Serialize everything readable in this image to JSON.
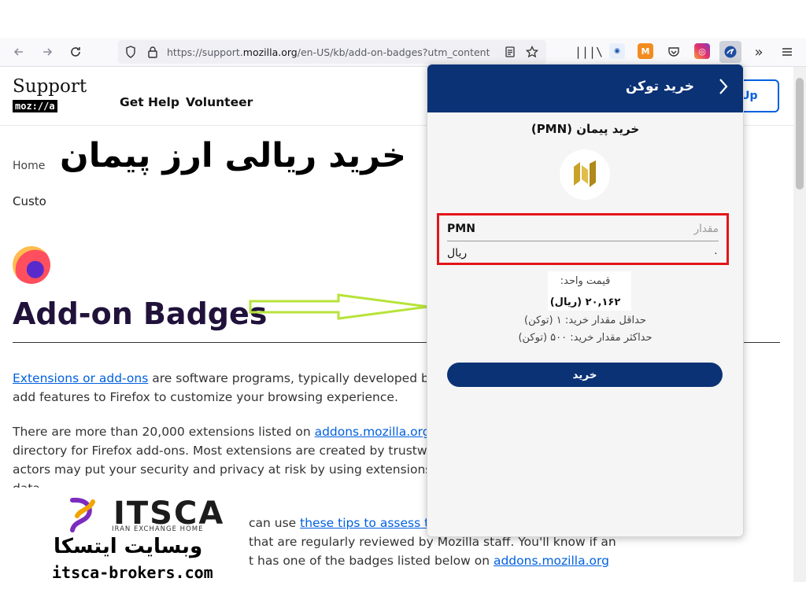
{
  "browser": {
    "url_prefix": "https://support.",
    "url_domain": "mozilla.org",
    "url_rest": "/en-US/kb/add-on-badges?utm_content="
  },
  "site": {
    "logo_text": "Support",
    "logo_moz": "moz://a",
    "nav": [
      "Get Help",
      "Volunteer"
    ],
    "signup_label": "/Up",
    "breadcrumb_home": "Home",
    "breadcrumb_custom": "Custo",
    "page_title": "Add-on Badges",
    "para1": {
      "link": "Extensions or add-ons",
      "line1_rest": " are software programs, typically developed by",
      "line2": "add features to Firefox to customize your browsing experience."
    },
    "para2": {
      "line1_text": "There are more than 20,000 extensions listed on ",
      "line1_link": "addons.mozilla.org (",
      "line2": "directory for Firefox add-ons. Most extensions are created by trustwo",
      "line3": "actors may put your security and privacy at risk by using extensions to",
      "line4": "data."
    },
    "para3": {
      "line1_text": "can use ",
      "line1_link": "these tips to assess t",
      "line2": "that are regularly reviewed by Mozilla staff. You'll know if an",
      "line3_text": "t has one of the badges listed below on ",
      "line3_link": "addons.mozilla.org"
    }
  },
  "overlay": {
    "title": "خرید ریالی ارز پیمان",
    "brand_word": "ITSCA",
    "brand_sub": "IRAN EXCHANGE HOME",
    "brand_fa": "وبسایت ایتسکا",
    "brand_url": "itsca-brokers.com"
  },
  "popup": {
    "header_title": "خرید توکن",
    "token_title": "خرید پیمان (PMN)",
    "amount_label": "PMN",
    "amount_placeholder": "مقدار",
    "rial_label": "ریال",
    "rial_value": "۰",
    "unit_price_label": "قیمت واحد:",
    "unit_price_value": "۲۰,۱۶۲ (ریال)",
    "min_purchase": "حداقل مقدار خرید: ۱ (توکن)",
    "max_purchase": "حداکثر مقدار خرید: ۵۰۰ (توکن)",
    "buy_button": "خرید"
  },
  "colors": {
    "popup_header": "#0b3275",
    "highlight_frame": "#e3151a",
    "link": "#0060df",
    "arrow": "#b7e33a"
  }
}
